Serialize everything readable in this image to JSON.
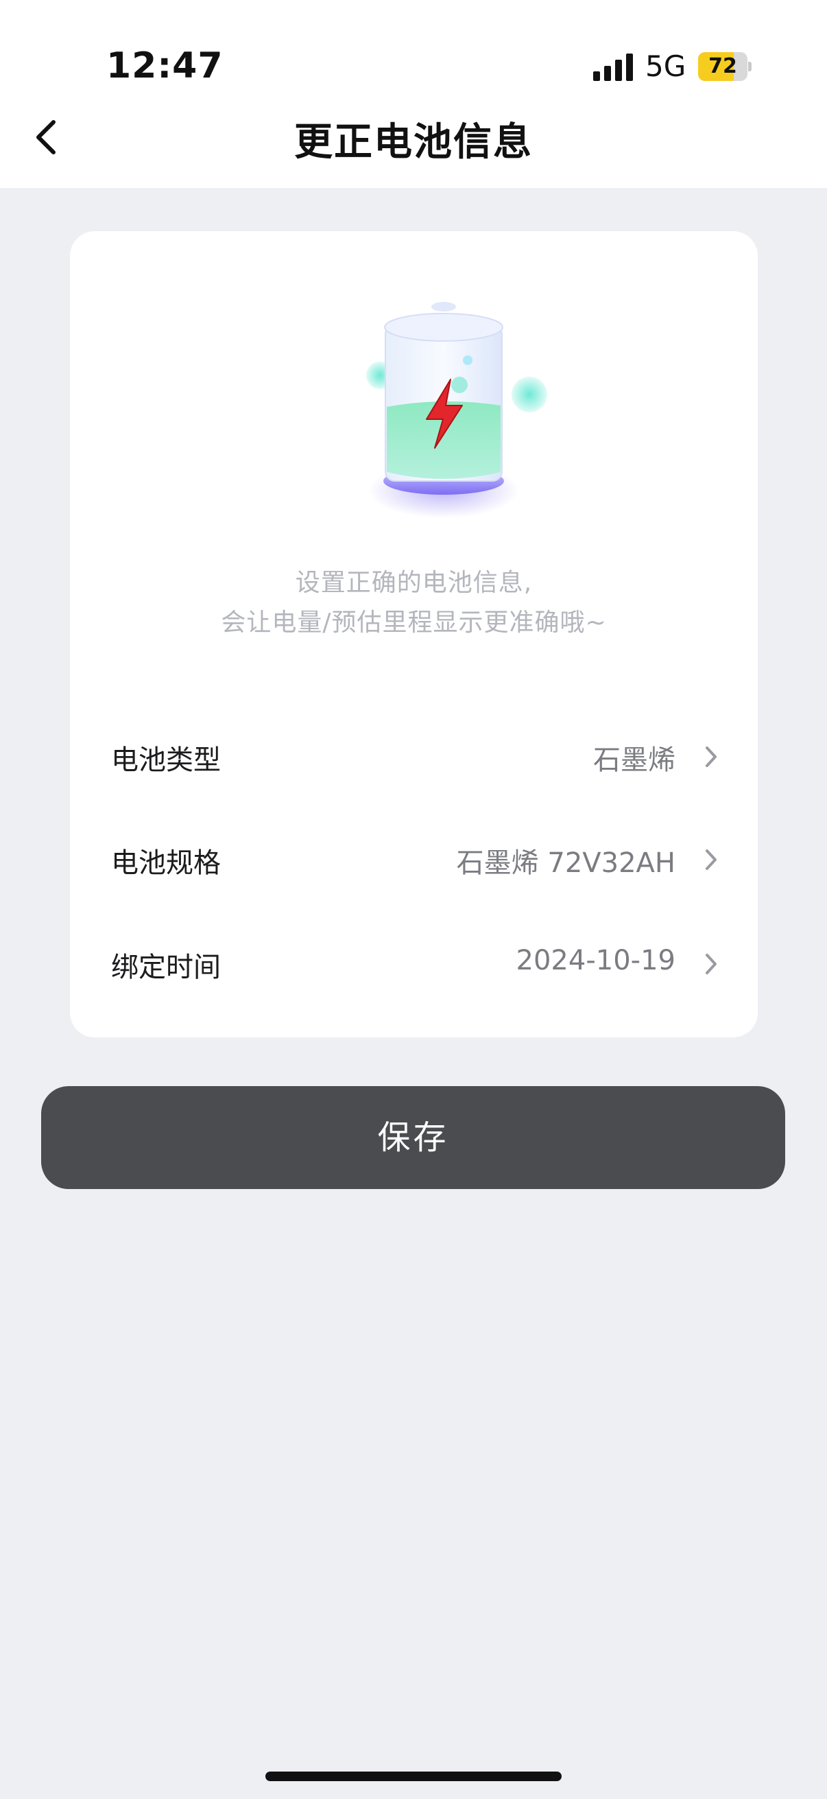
{
  "status_bar": {
    "time": "12:47",
    "network": "5G",
    "battery_level": "72",
    "battery_fraction": 0.72,
    "battery_color": "#f6cd1e"
  },
  "nav": {
    "title": "更正电池信息",
    "back_icon": "chevron-left-icon"
  },
  "card": {
    "illustration_icon": "battery-charging-icon",
    "tip_line1": "设置正确的电池信息,",
    "tip_line2": "会让电量/预估里程显示更准确哦~",
    "rows": [
      {
        "label": "电池类型",
        "value": "石墨烯"
      },
      {
        "label": "电池规格",
        "value": "石墨烯 72V32AH"
      },
      {
        "label": "绑定时间",
        "value": "2024-10-19"
      }
    ]
  },
  "save_button": {
    "label": "保存",
    "color": "#4b4c50"
  },
  "colors": {
    "background": "#eeeff3",
    "card": "#ffffff"
  }
}
